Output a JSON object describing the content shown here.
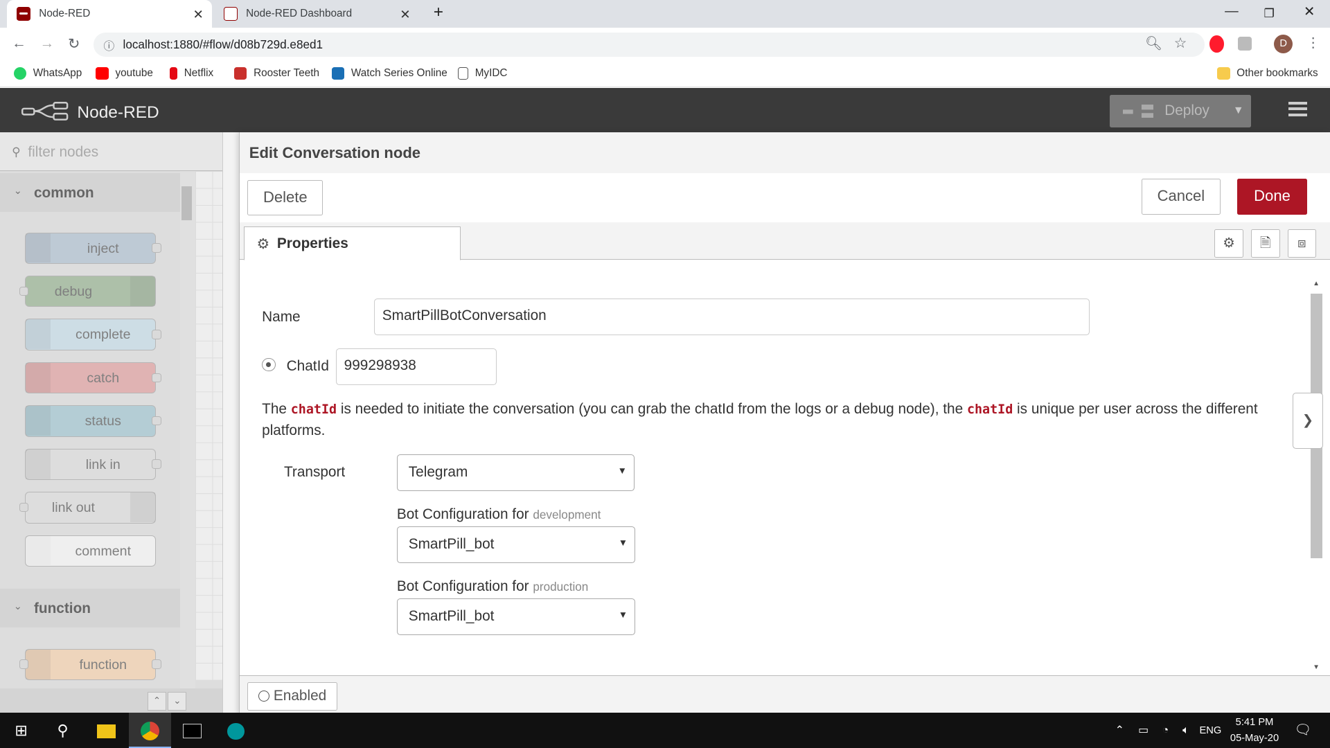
{
  "browser": {
    "tabs": [
      {
        "title": "Node-RED",
        "active": true
      },
      {
        "title": "Node-RED Dashboard",
        "active": false
      }
    ],
    "url": "localhost:1880/#flow/d08b729d.e8ed1",
    "profile_initial": "D",
    "bookmarks": [
      {
        "label": "WhatsApp",
        "color": "#25d366"
      },
      {
        "label": "youtube",
        "color": "#ff0000"
      },
      {
        "label": "Netflix",
        "color": "#e50914"
      },
      {
        "label": "Rooster Teeth",
        "color": "#c9302c"
      },
      {
        "label": "Watch Series Online",
        "color": "#1a6fb5"
      },
      {
        "label": "MyIDC",
        "color": "#555555"
      }
    ],
    "other_bookmarks": "Other bookmarks"
  },
  "header": {
    "title": "Node-RED",
    "deploy_label": "Deploy"
  },
  "palette": {
    "filter_placeholder": "filter nodes",
    "categories": [
      {
        "label": "common"
      },
      {
        "label": "function"
      }
    ],
    "nodes": [
      {
        "label": "inject",
        "color": "#a6bbcf"
      },
      {
        "label": "debug",
        "color": "#87a980"
      },
      {
        "label": "complete",
        "color": "#c0deed"
      },
      {
        "label": "catch",
        "color": "#e49191"
      },
      {
        "label": "status",
        "color": "#94c1d0"
      },
      {
        "label": "link in",
        "color": "#dddddd"
      },
      {
        "label": "link out",
        "color": "#dddddd"
      },
      {
        "label": "comment",
        "color": "#ffffff"
      },
      {
        "label": "function",
        "color": "#fdd0a2"
      }
    ]
  },
  "editor": {
    "title": "Edit Conversation node",
    "delete_label": "Delete",
    "cancel_label": "Cancel",
    "done_label": "Done",
    "tab_properties": "Properties",
    "name_label": "Name",
    "name_value": "SmartPillBotConversation",
    "chatid_label": "ChatId",
    "chatid_value": "999298938",
    "help_parts": {
      "p1": "The ",
      "c1": "chatId",
      "p2": " is needed to initiate the conversation (you can grab the chatId from the logs or a debug node), the ",
      "c2": "chatId",
      "p3": " is unique per user across the different platforms."
    },
    "transport_label": "Transport",
    "transport_value": "Telegram",
    "bot_config_label": "Bot Configuration for",
    "dev_env": "development",
    "dev_bot": "SmartPill_bot",
    "prod_env": "production",
    "prod_bot": "SmartPill_bot",
    "enabled_label": "Enabled"
  },
  "taskbar": {
    "time": "5:41 PM",
    "date": "05-May-20",
    "lang": "ENG"
  },
  "colors": {
    "accent": "#ad1625",
    "header_bg": "#3a3a3a"
  }
}
